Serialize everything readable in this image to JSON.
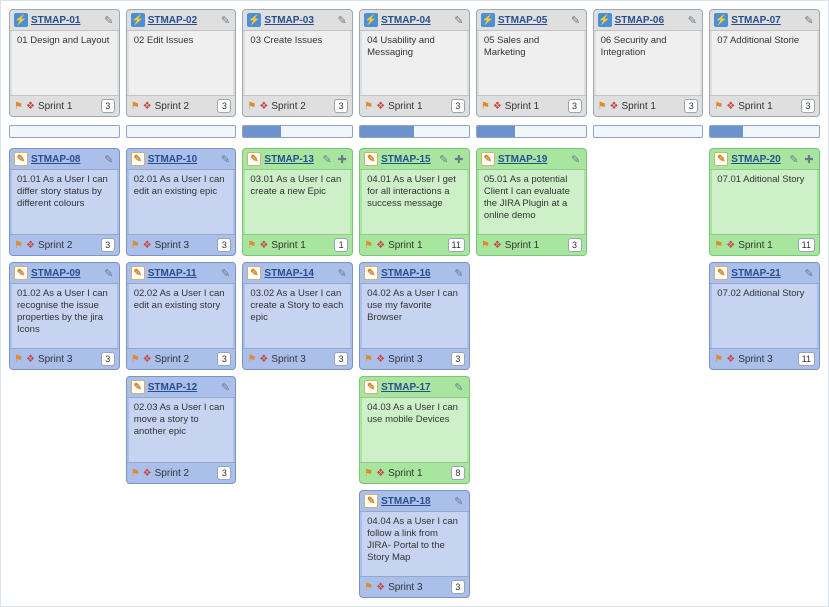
{
  "columns": [
    {
      "id": "STMAP-01",
      "desc": "01 Design and Layout",
      "sprint": "Sprint 1",
      "points": 3
    },
    {
      "id": "STMAP-02",
      "desc": "02 Edit Issues",
      "sprint": "Sprint 2",
      "points": 3
    },
    {
      "id": "STMAP-03",
      "desc": "03 Create Issues",
      "sprint": "Sprint 2",
      "points": 3
    },
    {
      "id": "STMAP-04",
      "desc": "04 Usability and Messaging",
      "sprint": "Sprint 1",
      "points": 3
    },
    {
      "id": "STMAP-05",
      "desc": "05 Sales and Marketing",
      "sprint": "Sprint 1",
      "points": 3
    },
    {
      "id": "STMAP-06",
      "desc": "06 Security and Integration",
      "sprint": "Sprint 1",
      "points": 3
    },
    {
      "id": "STMAP-07",
      "desc": "07 Additional Storie",
      "sprint": "Sprint 1",
      "points": 3
    }
  ],
  "progress": [
    0,
    0,
    35,
    50,
    35,
    0,
    30
  ],
  "stories": [
    [
      {
        "id": "STMAP-08",
        "desc": "01.01 As a User I can differ story status by different colours",
        "sprint": "Sprint 2",
        "points": 3,
        "color": "blue"
      },
      {
        "id": "STMAP-09",
        "desc": "01.02 As a User I can recognise the issue properties by the jira Icons",
        "sprint": "Sprint 3",
        "points": 3,
        "color": "blue"
      }
    ],
    [
      {
        "id": "STMAP-10",
        "desc": "02.01 As a User I can edit an existing epic",
        "sprint": "Sprint 3",
        "points": 3,
        "color": "blue"
      },
      {
        "id": "STMAP-11",
        "desc": "02.02 As a User I can edit an existing story",
        "sprint": "Sprint 2",
        "points": 3,
        "color": "blue"
      },
      {
        "id": "STMAP-12",
        "desc": "02.03 As a User I can move a story to another epic",
        "sprint": "Sprint 2",
        "points": 3,
        "color": "blue"
      }
    ],
    [
      {
        "id": "STMAP-13",
        "desc": "03.01 As a User I can create a new Epic",
        "sprint": "Sprint 1",
        "points": 1,
        "color": "green",
        "showAdd": true
      },
      {
        "id": "STMAP-14",
        "desc": "03.02 As a User I can create a Story to each epic",
        "sprint": "Sprint 3",
        "points": 3,
        "color": "blue"
      }
    ],
    [
      {
        "id": "STMAP-15",
        "desc": "04.01 As a User I get for all interactions a success message",
        "sprint": "Sprint 1",
        "points": 11,
        "color": "green",
        "showAdd": true
      },
      {
        "id": "STMAP-16",
        "desc": "04.02 As a User I can use my favorite Browser",
        "sprint": "Sprint 3",
        "points": 3,
        "color": "blue"
      },
      {
        "id": "STMAP-17",
        "desc": "04.03 As a User I can use mobile Devices",
        "sprint": "Sprint 1",
        "points": 8,
        "color": "green"
      },
      {
        "id": "STMAP-18",
        "desc": "04.04 As a User I can follow a link from JIRA- Portal to the Story Map",
        "sprint": "Sprint 3",
        "points": 3,
        "color": "blue"
      }
    ],
    [
      {
        "id": "STMAP-19",
        "desc": "05.01 As a potential Client I can evaluate the JIRA Plugin at a online demo",
        "sprint": "Sprint 1",
        "points": 3,
        "color": "green"
      }
    ],
    [],
    [
      {
        "id": "STMAP-20",
        "desc": "07.01 Aditional Story",
        "sprint": "Sprint 1",
        "points": 11,
        "color": "green",
        "showAdd": true
      },
      {
        "id": "STMAP-21",
        "desc": "07.02 Aditional Story",
        "sprint": "Sprint 3",
        "points": 11,
        "color": "blue"
      }
    ]
  ]
}
